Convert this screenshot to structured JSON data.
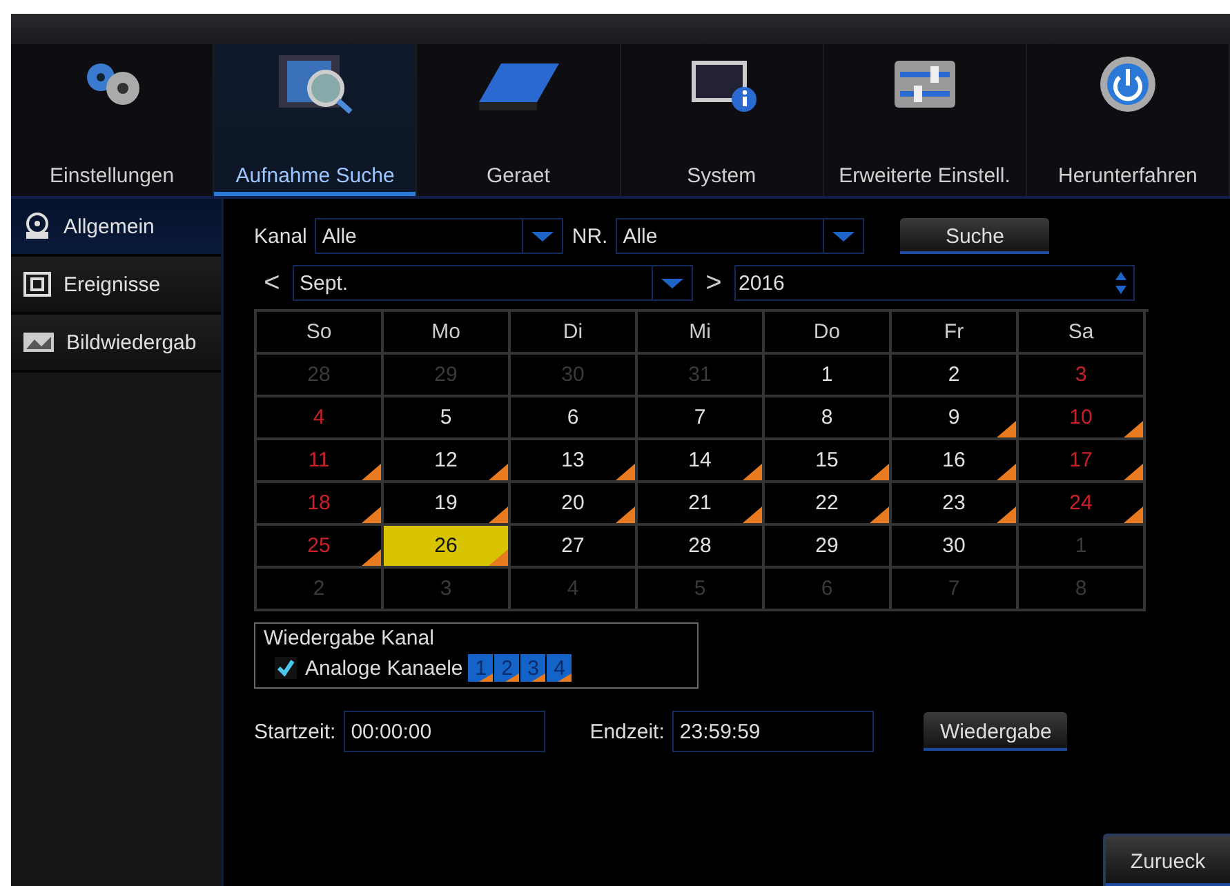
{
  "nav": [
    {
      "label": "Einstellungen",
      "selected": false
    },
    {
      "label": "Aufnahme Suche",
      "selected": true
    },
    {
      "label": "Geraet",
      "selected": false
    },
    {
      "label": "System",
      "selected": false
    },
    {
      "label": "Erweiterte Einstell.",
      "selected": false
    },
    {
      "label": "Herunterfahren",
      "selected": false
    }
  ],
  "sidebar": {
    "items": [
      {
        "label": "Allgemein",
        "selected": true
      },
      {
        "label": "Ereignisse",
        "selected": false
      },
      {
        "label": "Bildwiedergab",
        "selected": false
      }
    ]
  },
  "filters": {
    "channel_label": "Kanal",
    "channel_value": "Alle",
    "nr_label": "NR.",
    "nr_value": "Alle",
    "search_button": "Suche"
  },
  "month_bar": {
    "prev": "<",
    "month": "Sept.",
    "next": ">",
    "year": "2016"
  },
  "calendar": {
    "weekdays": [
      "So",
      "Mo",
      "Di",
      "Mi",
      "Do",
      "Fr",
      "Sa"
    ],
    "days": [
      {
        "text": "28",
        "kind": "other",
        "record": false,
        "selected": false
      },
      {
        "text": "29",
        "kind": "other",
        "record": false,
        "selected": false
      },
      {
        "text": "30",
        "kind": "other",
        "record": false,
        "selected": false
      },
      {
        "text": "31",
        "kind": "other",
        "record": false,
        "selected": false
      },
      {
        "text": "1",
        "kind": "weekday",
        "record": false,
        "selected": false
      },
      {
        "text": "2",
        "kind": "weekday",
        "record": false,
        "selected": false
      },
      {
        "text": "3",
        "kind": "weekend",
        "record": false,
        "selected": false
      },
      {
        "text": "4",
        "kind": "weekend",
        "record": false,
        "selected": false
      },
      {
        "text": "5",
        "kind": "weekday",
        "record": false,
        "selected": false
      },
      {
        "text": "6",
        "kind": "weekday",
        "record": false,
        "selected": false
      },
      {
        "text": "7",
        "kind": "weekday",
        "record": false,
        "selected": false
      },
      {
        "text": "8",
        "kind": "weekday",
        "record": false,
        "selected": false
      },
      {
        "text": "9",
        "kind": "weekday",
        "record": true,
        "selected": false
      },
      {
        "text": "10",
        "kind": "weekend",
        "record": true,
        "selected": false
      },
      {
        "text": "11",
        "kind": "weekend",
        "record": true,
        "selected": false
      },
      {
        "text": "12",
        "kind": "weekday",
        "record": true,
        "selected": false
      },
      {
        "text": "13",
        "kind": "weekday",
        "record": true,
        "selected": false
      },
      {
        "text": "14",
        "kind": "weekday",
        "record": true,
        "selected": false
      },
      {
        "text": "15",
        "kind": "weekday",
        "record": true,
        "selected": false
      },
      {
        "text": "16",
        "kind": "weekday",
        "record": true,
        "selected": false
      },
      {
        "text": "17",
        "kind": "weekend",
        "record": true,
        "selected": false
      },
      {
        "text": "18",
        "kind": "weekend",
        "record": true,
        "selected": false
      },
      {
        "text": "19",
        "kind": "weekday",
        "record": true,
        "selected": false
      },
      {
        "text": "20",
        "kind": "weekday",
        "record": true,
        "selected": false
      },
      {
        "text": "21",
        "kind": "weekday",
        "record": true,
        "selected": false
      },
      {
        "text": "22",
        "kind": "weekday",
        "record": true,
        "selected": false
      },
      {
        "text": "23",
        "kind": "weekday",
        "record": true,
        "selected": false
      },
      {
        "text": "24",
        "kind": "weekend",
        "record": true,
        "selected": false
      },
      {
        "text": "25",
        "kind": "weekend",
        "record": true,
        "selected": false
      },
      {
        "text": "26",
        "kind": "weekday",
        "record": true,
        "selected": true
      },
      {
        "text": "27",
        "kind": "weekday",
        "record": false,
        "selected": false
      },
      {
        "text": "28",
        "kind": "weekday",
        "record": false,
        "selected": false
      },
      {
        "text": "29",
        "kind": "weekday",
        "record": false,
        "selected": false
      },
      {
        "text": "30",
        "kind": "weekday",
        "record": false,
        "selected": false
      },
      {
        "text": "1",
        "kind": "other",
        "record": false,
        "selected": false
      },
      {
        "text": "2",
        "kind": "other",
        "record": false,
        "selected": false
      },
      {
        "text": "3",
        "kind": "other",
        "record": false,
        "selected": false
      },
      {
        "text": "4",
        "kind": "other",
        "record": false,
        "selected": false
      },
      {
        "text": "5",
        "kind": "other",
        "record": false,
        "selected": false
      },
      {
        "text": "6",
        "kind": "other",
        "record": false,
        "selected": false
      },
      {
        "text": "7",
        "kind": "other",
        "record": false,
        "selected": false
      },
      {
        "text": "8",
        "kind": "other",
        "record": false,
        "selected": false
      }
    ]
  },
  "playback_channels": {
    "title": "Wiedergabe Kanal",
    "option_label": "Analoge Kanaele",
    "checked": true,
    "channels": [
      {
        "text": "1",
        "record": true
      },
      {
        "text": "2",
        "record": true
      },
      {
        "text": "3",
        "record": true
      },
      {
        "text": "4",
        "record": true
      }
    ]
  },
  "time_range": {
    "start_label": "Startzeit:",
    "start_value": "00:00:00",
    "end_label": "Endzeit:",
    "end_value": "23:59:59",
    "play_button": "Wiedergabe"
  },
  "back_button": "Zurueck"
}
